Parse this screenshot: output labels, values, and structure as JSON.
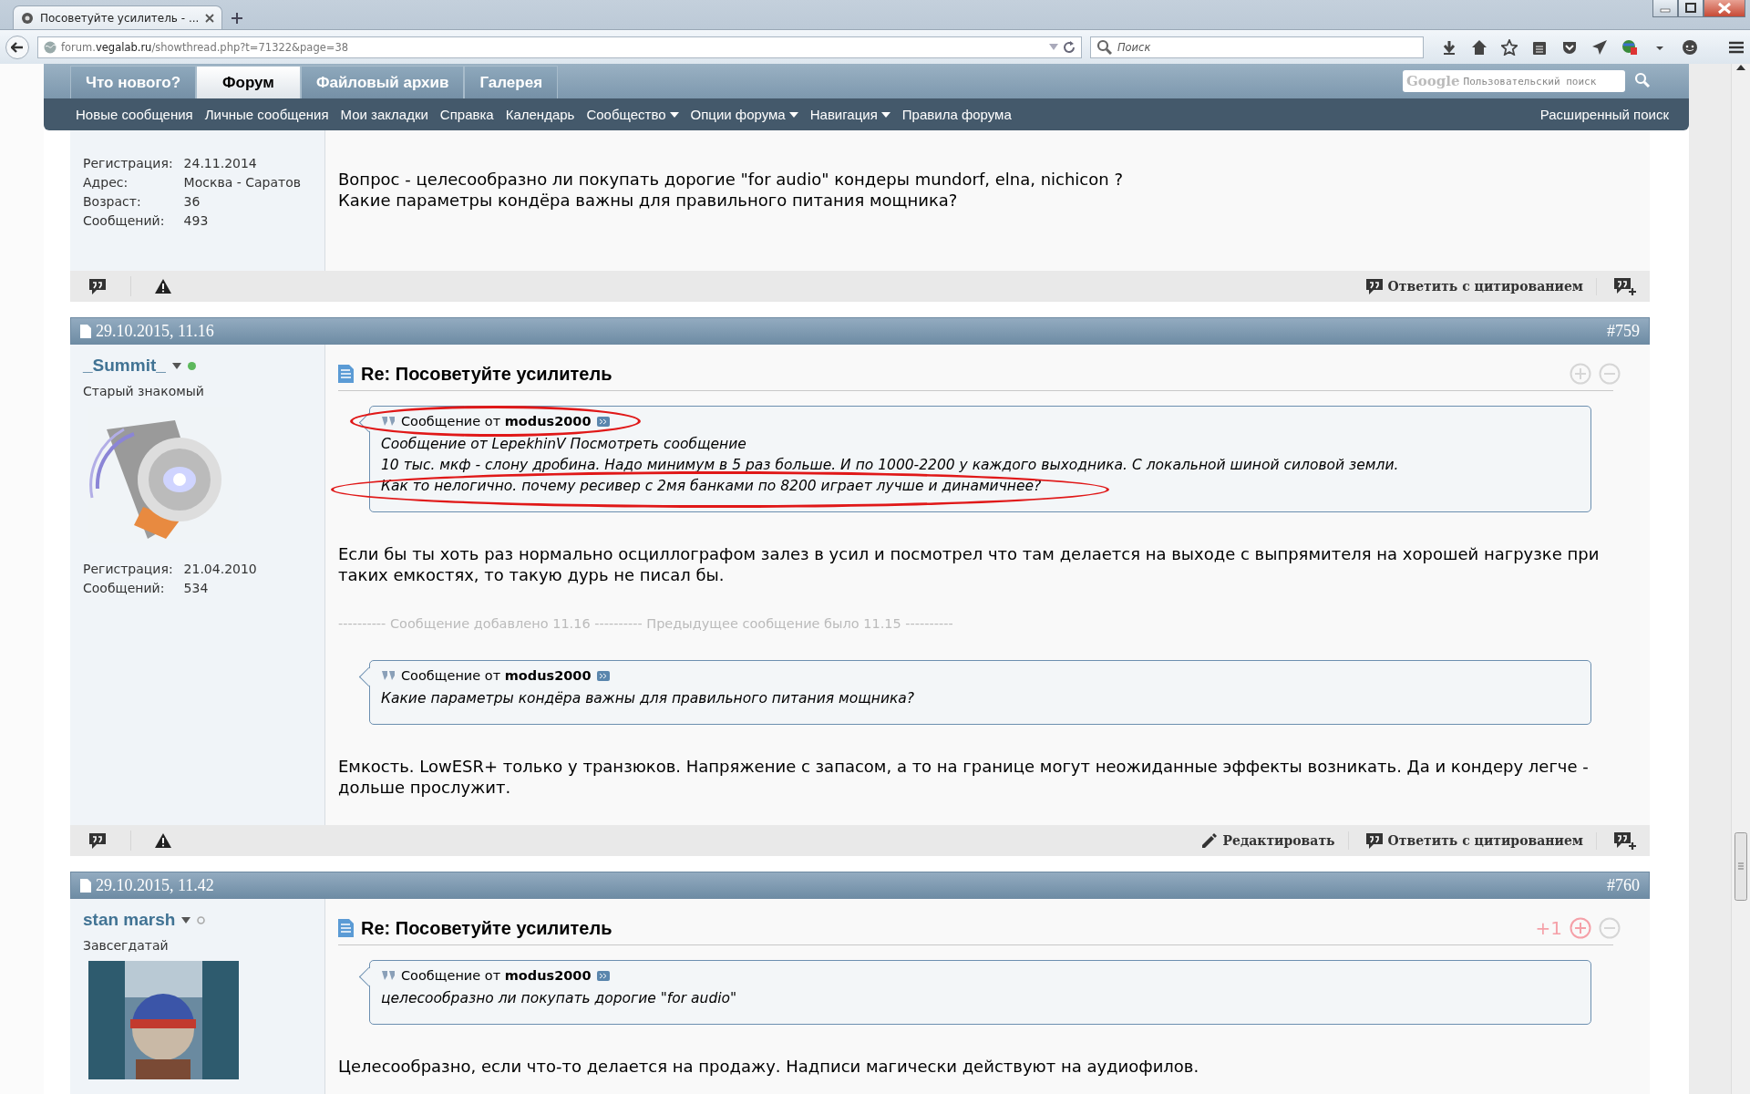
{
  "browser": {
    "tab_title": "Посоветуйте усилитель - ...",
    "url": "forum.**vegalab.ru**/showthread.php?t=71322&page=38",
    "search_placeholder": "Поиск"
  },
  "forum_nav": {
    "tabs": [
      {
        "label": "Что нового?",
        "selected": false
      },
      {
        "label": "Форум",
        "selected": true
      },
      {
        "label": "Файловый архив",
        "selected": false
      },
      {
        "label": "Галерея",
        "selected": false
      }
    ],
    "search_logo": "Google",
    "search_placeholder": "Пользовательский поиск",
    "links": [
      {
        "label": "Новые сообщения",
        "dropdown": false
      },
      {
        "label": "Личные сообщения",
        "dropdown": false
      },
      {
        "label": "Мои закладки",
        "dropdown": false
      },
      {
        "label": "Справка",
        "dropdown": false
      },
      {
        "label": "Календарь",
        "dropdown": false
      },
      {
        "label": "Сообщество",
        "dropdown": true
      },
      {
        "label": "Опции форума",
        "dropdown": true
      },
      {
        "label": "Навигация",
        "dropdown": true
      },
      {
        "label": "Правила форума",
        "dropdown": false
      }
    ],
    "advanced_search": "Расширенный поиск"
  },
  "posts": [
    {
      "info": [
        {
          "label": "Регистрация:",
          "value": "24.11.2014"
        },
        {
          "label": "Адрес:",
          "value": "Москва - Саратов"
        },
        {
          "label": "Возраст:",
          "value": "36"
        },
        {
          "label": "Сообщений:",
          "value": "493"
        }
      ],
      "blocks": [
        {
          "kind": "text",
          "text": "Вопрос - целесообразно ли покупать дорогие \"for audio\" кондеры mundorf, elna, nichicon ?\nКакие параметры кондёра важны для правильного питания мощника?"
        }
      ],
      "actions": [
        {
          "kind": "quote",
          "label": "Ответить с цитированием"
        }
      ]
    },
    {
      "date": "29.10.2015, 11.16",
      "number": "#759",
      "username": "_Summit_",
      "online": true,
      "rank": "Старый знакомый",
      "avatar": {
        "kind": "picture"
      },
      "info": [
        {
          "label": "Регистрация:",
          "value": "21.04.2010"
        },
        {
          "label": "Сообщений:",
          "value": "534"
        }
      ],
      "title": "Re: Посоветуйте усилитель",
      "liked": false,
      "blocks": [
        {
          "kind": "quote",
          "header": "Сообщение от **modus2000**",
          "header_circled": true,
          "last_line_circled": true,
          "lines": [
            "Сообщение от LepekhinV Посмотреть сообщение",
            "10 тыс. мкф - слону дробина. Надо минимум в 5 раз больше. И по 1000-2200 у каждого выходника. С локальной шиной силовой земли.",
            "Как то нелогично. почему ресивер с 2мя банками по 8200 играет лучше и динамичнее?"
          ]
        },
        {
          "kind": "text",
          "text": "Если бы ты хоть раз нормально осциллографом залез в усил и посмотрел что там делается на выходе с выпрямителя на хорошей нагрузке при таких емкостях, то такую дурь не писал бы."
        },
        {
          "kind": "merge",
          "text": "---------- Сообщение добавлено 11.16 ---------- Предыдущее сообщение было 11.15 ----------"
        },
        {
          "kind": "quote",
          "header": "Сообщение от **modus2000**",
          "header_circled": false,
          "last_line_circled": false,
          "lines": [
            "Какие параметры кондёра важны для правильного питания мощника?"
          ]
        },
        {
          "kind": "text",
          "text": "Емкость. LowESR+ только у транзюков. Напряжение с запасом, а то на границе могут неожиданные эффекты возникать. Да и кондеру легче - дольше прослужит."
        }
      ],
      "actions": [
        {
          "kind": "edit",
          "label": "Редактировать"
        },
        {
          "kind": "quote",
          "label": "Ответить с цитированием"
        }
      ]
    },
    {
      "date": "29.10.2015, 11.42",
      "number": "#760",
      "username": "stan marsh",
      "online": false,
      "rank": "Завсегдатай",
      "avatar": {
        "kind": "picture"
      },
      "title": "Re: Посоветуйте усилитель",
      "score": "+1",
      "liked": true,
      "blocks": [
        {
          "kind": "quote",
          "header": "Сообщение от **modus2000**",
          "header_circled": false,
          "last_line_circled": false,
          "lines": [
            "целесообразно ли покупать дорогие \"for audio\""
          ]
        },
        {
          "kind": "text",
          "text": "Целесообразно, если что-то делается на продажу. Надписи магически действуют на аудиофилов."
        }
      ]
    }
  ]
}
